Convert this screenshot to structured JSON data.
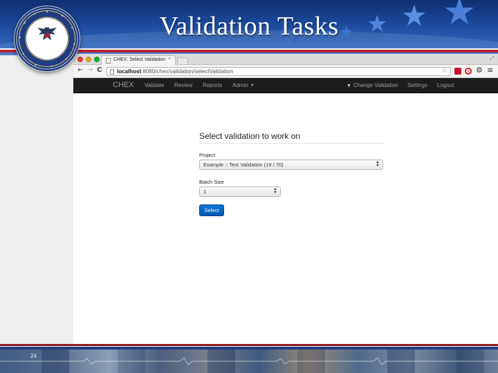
{
  "slide": {
    "title": "Validation Tasks",
    "page_number": "24",
    "colors": {
      "banner_blue": "#1d4a9c",
      "accent_red": "#b22234",
      "primary_button": "#0a6bc9"
    }
  },
  "seal": {
    "text": "DEPARTMENT OF VETERANS AFFAIRS · UNITED STATES OF AMERICA",
    "icon": "va-seal-icon"
  },
  "browser": {
    "tab_title": "CHEX: Select Validation",
    "tab_close": "×",
    "url_host": "localhost",
    "url_path": ":8080/chex/validation/selectValidation",
    "icons": [
      "back-arrow-icon",
      "forward-arrow-icon",
      "reload-icon",
      "bookmark-star-icon",
      "extension-icon",
      "opera-icon",
      "gear-icon",
      "menu-icon"
    ]
  },
  "nav": {
    "brand": "CHEX",
    "links": [
      "Validate",
      "Review",
      "Reports",
      "Admin"
    ],
    "right_links": [
      "Change Validation",
      "Settings",
      "Logout"
    ]
  },
  "form": {
    "heading": "Select validation to work on",
    "project_label": "Project",
    "project_value": "Example :: Test Validation (19 / 70)",
    "batch_label": "Batch Size",
    "batch_value": "1",
    "submit_label": "Select"
  }
}
